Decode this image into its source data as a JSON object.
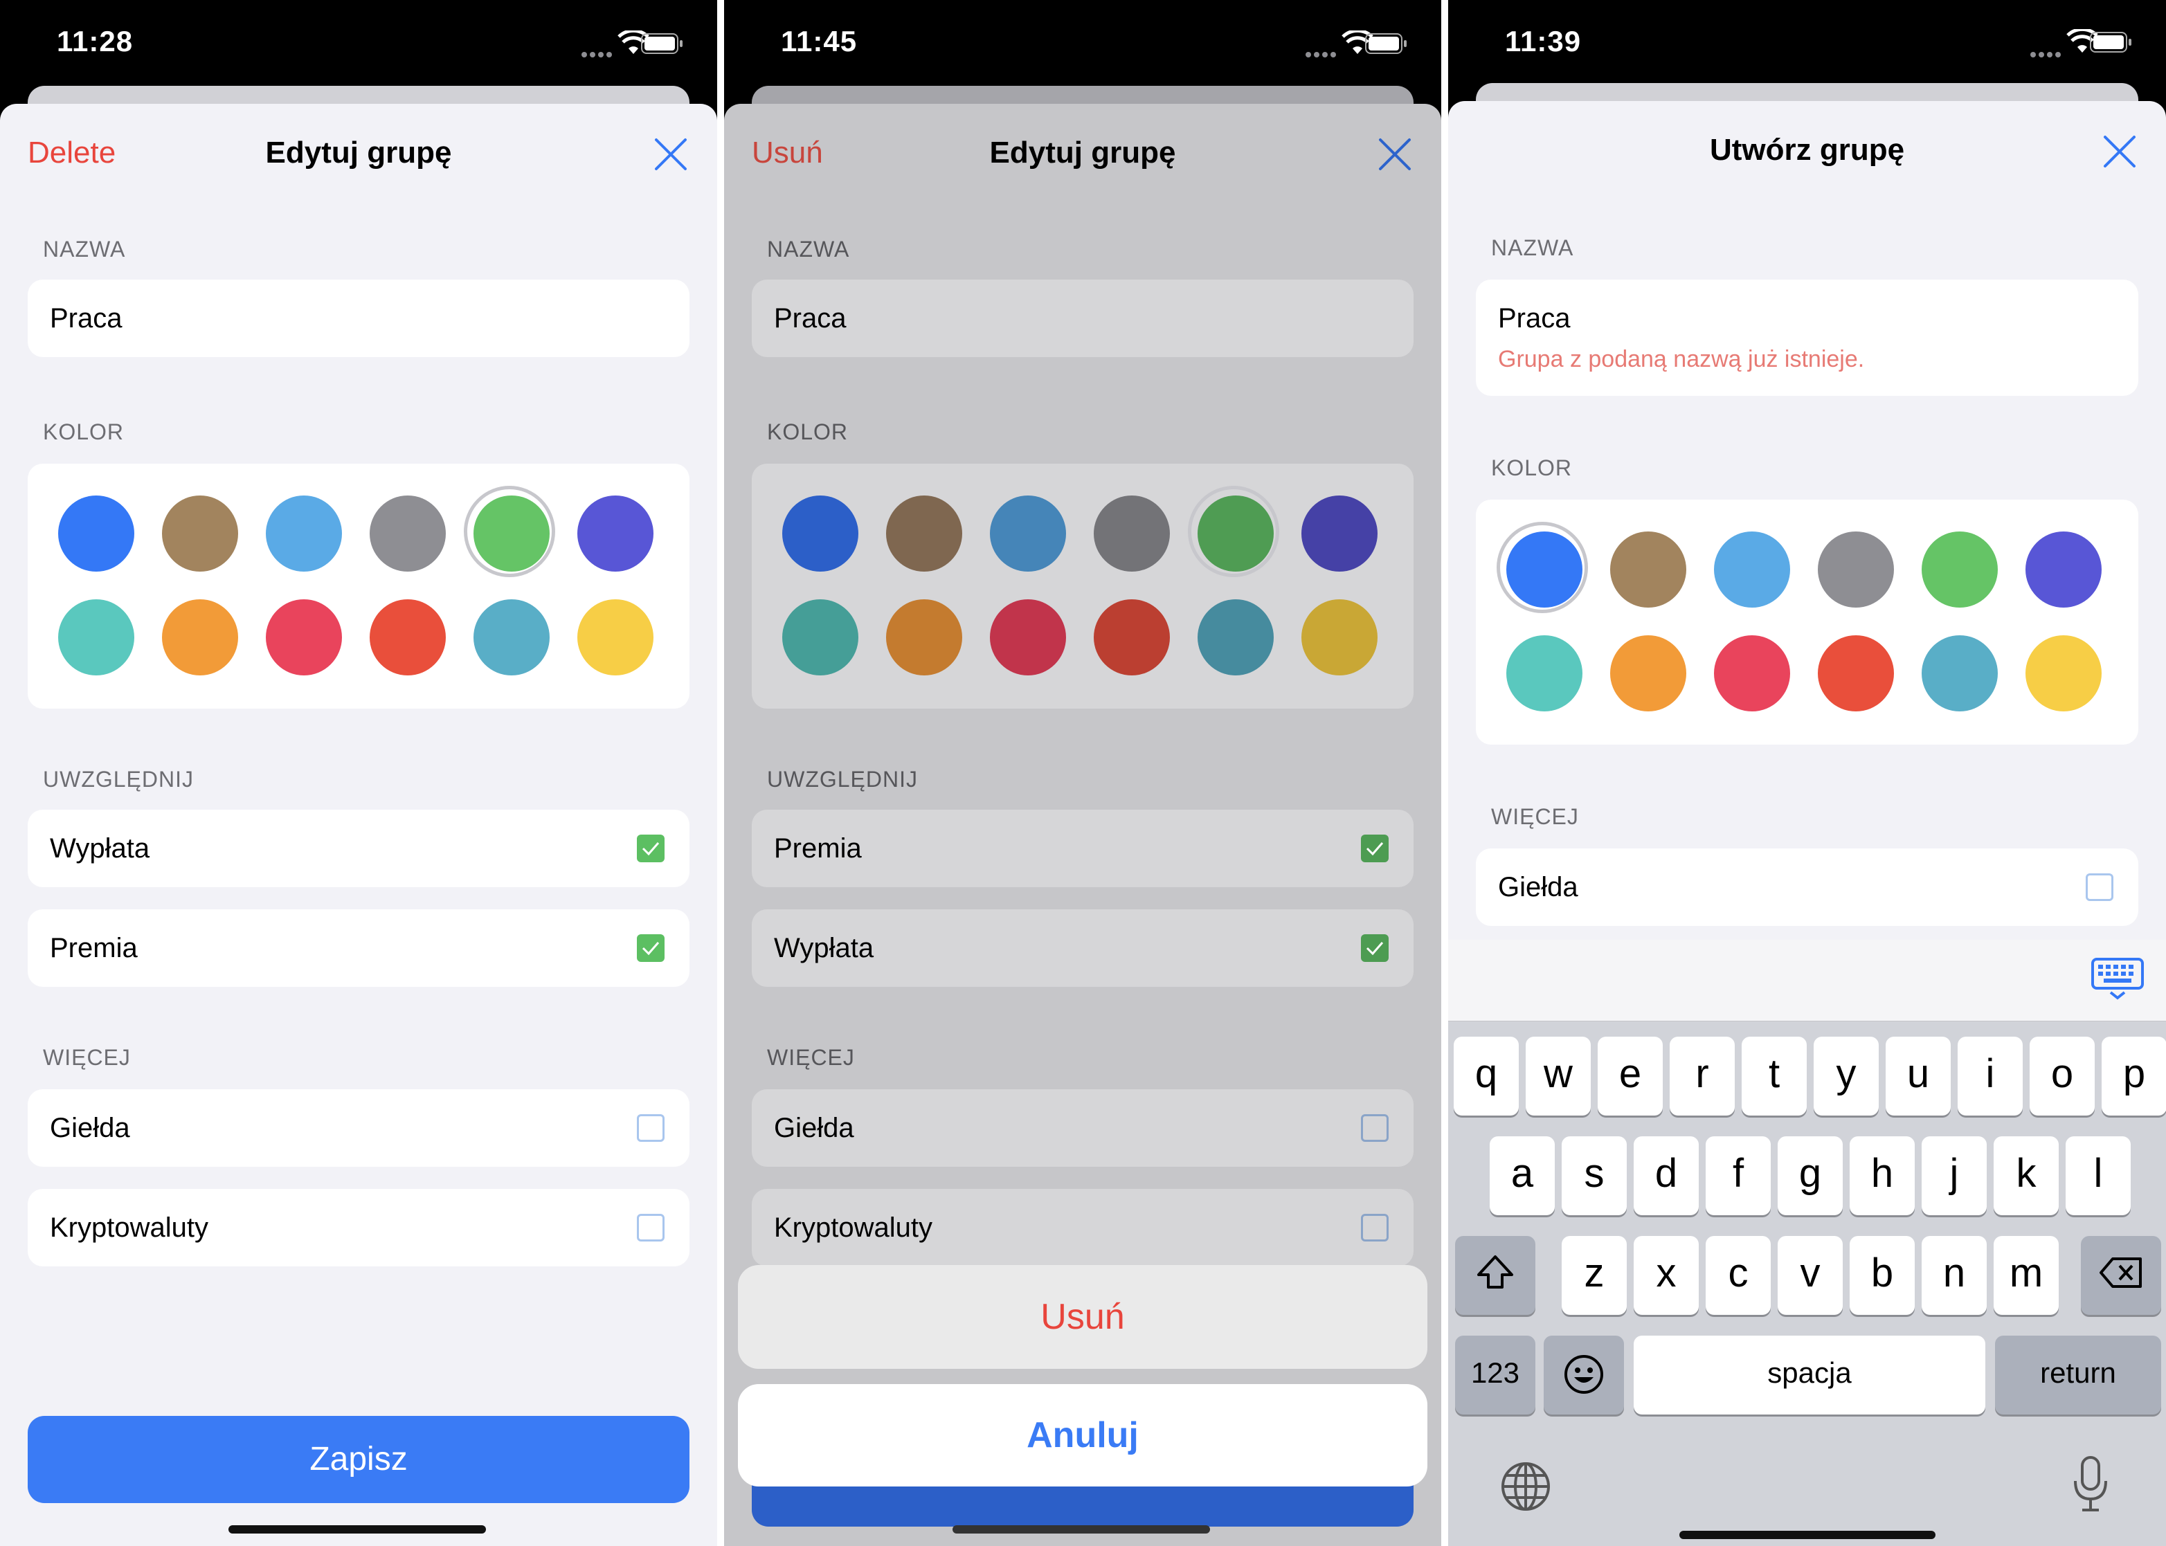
{
  "screens": [
    {
      "time": "11:28",
      "nav": {
        "left_label": "Delete",
        "title": "Edytuj grupę"
      },
      "name_section": {
        "title": "NAZWA",
        "value": "Praca"
      },
      "color_section": {
        "title": "KOLOR",
        "selected_index": 4
      },
      "include_section": {
        "title": "UWZGLĘDNIJ",
        "items": [
          {
            "label": "Wypłata",
            "checked": true
          },
          {
            "label": "Premia",
            "checked": true
          }
        ]
      },
      "more_section": {
        "title": "WIĘCEJ",
        "items": [
          {
            "label": "Giełda",
            "checked": false
          },
          {
            "label": "Kryptowaluty",
            "checked": false
          }
        ]
      },
      "save_label": "Zapisz"
    },
    {
      "time": "11:45",
      "nav": {
        "left_label": "Usuń",
        "title": "Edytuj grupę"
      },
      "name_section": {
        "title": "NAZWA",
        "value": "Praca"
      },
      "color_section": {
        "title": "KOLOR",
        "selected_index": 4
      },
      "include_section": {
        "title": "UWZGLĘDNIJ",
        "items": [
          {
            "label": "Premia",
            "checked": true
          },
          {
            "label": "Wypłata",
            "checked": true
          }
        ]
      },
      "more_section": {
        "title": "WIĘCEJ",
        "items": [
          {
            "label": "Giełda",
            "checked": false
          },
          {
            "label": "Kryptowaluty",
            "checked": false
          }
        ]
      },
      "action_sheet": {
        "delete_label": "Usuń",
        "cancel_label": "Anuluj"
      }
    },
    {
      "time": "11:39",
      "nav": {
        "title": "Utwórz grupę"
      },
      "name_section": {
        "title": "NAZWA",
        "value": "Praca",
        "error": "Grupa z podaną nazwą już istnieje."
      },
      "color_section": {
        "title": "KOLOR",
        "selected_index": 0
      },
      "more_section": {
        "title": "WIĘCEJ",
        "items": [
          {
            "label": "Giełda",
            "checked": false
          }
        ]
      },
      "keyboard": {
        "row1": [
          "q",
          "w",
          "e",
          "r",
          "t",
          "y",
          "u",
          "i",
          "o",
          "p"
        ],
        "row2": [
          "a",
          "s",
          "d",
          "f",
          "g",
          "h",
          "j",
          "k",
          "l"
        ],
        "row3": [
          "z",
          "x",
          "c",
          "v",
          "b",
          "n",
          "m"
        ],
        "numbers_label": "123",
        "space_label": "spacja",
        "return_label": "return"
      }
    }
  ],
  "palette": {
    "normal": [
      "#3478f6",
      "#a2845e",
      "#5aaae6",
      "#8e8e93",
      "#65c466",
      "#5856d6",
      "#5ac8be",
      "#f29b38",
      "#e9445c",
      "#e94f3b",
      "#59aec7",
      "#f7ce46"
    ],
    "dimmed": [
      "#2c5fc8",
      "#7f6750",
      "#4585b8",
      "#737377",
      "#4f9c53",
      "#4541a6",
      "#459e97",
      "#c47b2f",
      "#c1344b",
      "#bb3f31",
      "#468b9e",
      "#c9a735"
    ]
  }
}
